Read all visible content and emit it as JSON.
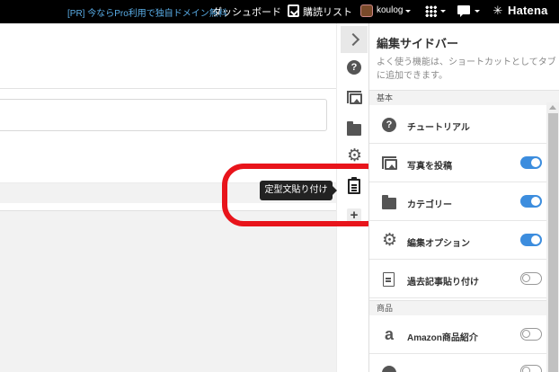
{
  "topbar": {
    "promo": "[PR] 今ならPro利用で独自ドメイン無料",
    "dashboard": "ダッシュボード",
    "subscriptions": "購読リスト",
    "user": "koulog",
    "brand": "Hatena"
  },
  "rail": {
    "tooltip": "定型文貼り付け"
  },
  "panel": {
    "title": "編集サイドバー",
    "description": "よく使う機能は、ショートカットとしてタブに追加できます。",
    "sections": [
      {
        "label": "基本",
        "items": [
          {
            "label": "チュートリアル",
            "icon": "question-icon",
            "toggle": "none"
          },
          {
            "label": "写真を投稿",
            "icon": "photo-icon",
            "toggle": "on"
          },
          {
            "label": "カテゴリー",
            "icon": "folder-icon",
            "toggle": "on"
          },
          {
            "label": "編集オプション",
            "icon": "gear-icon",
            "toggle": "on"
          },
          {
            "label": "過去記事貼り付け",
            "icon": "document-icon",
            "toggle": "off"
          }
        ]
      },
      {
        "label": "商品",
        "items": [
          {
            "label": "Amazon商品紹介",
            "icon": "amazon-icon",
            "toggle": "off"
          }
        ]
      }
    ]
  },
  "colors": {
    "highlight": "#e8141b",
    "toggle_on": "#3c8dde",
    "promo": "#5aaee8"
  }
}
